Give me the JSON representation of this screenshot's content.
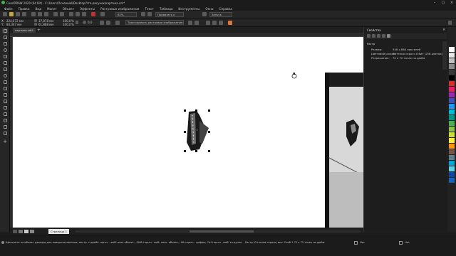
{
  "app": {
    "title": "CorelDRAW 2020 (64 Bit) - C:\\Users\\Основной\\Desktop\\Что-рисунок\\картина.cdr*"
  },
  "menu": [
    "Файл",
    "Правка",
    "Вид",
    "Макет",
    "Объект",
    "Эффекты",
    "Растровые изображения",
    "Текст",
    "Таблица",
    "Инструменты",
    "Окно",
    "Справка"
  ],
  "toolbar1": {
    "zoom": "62%",
    "snap_label": "Привязать к",
    "launch_label": "Запуск"
  },
  "toolbar2": {
    "x_value": "224,572 мм",
    "y_value": "84,347 мм",
    "w_value": "37,878 мм",
    "h_value": "61,888 мм",
    "scale_w": "100,0",
    "scale_h": "100,0",
    "percent": "%",
    "angle": "0,0",
    "dropdown": "Трассировать растровое изображение"
  },
  "document": {
    "tab_label": "картина.cdr*",
    "page_tab": "Страница 1"
  },
  "properties_panel": {
    "title": "Свойства",
    "section": "Растр",
    "rows": [
      {
        "label": "Размер:",
        "value": "346 x 864 пикселей"
      },
      {
        "label": "Цветовой режим:",
        "value": "Оттенки серого 8 бит (256 цветов)"
      },
      {
        "label": "Разрешение:",
        "value": "72 x 72 точек на дюйм"
      }
    ]
  },
  "status": {
    "hint": "Щелкните на объект дважды для поворота/наклона; инстр. с двойн. щелч. - выб. всех объект.; Shift+щелч - выб. неск. объект.; Alt+щелч - цифры; Ctrl+щелч - выб. в группе",
    "object_info": "Растр (Оттенки серого) вкл. Слой 1 72 x 72 точек на дюйм",
    "fill": "Нет",
    "outline": "Нет"
  },
  "colors": {
    "canvas": "#ffffff",
    "workspace": "#1e1e1e",
    "accent": "#2f6fd0"
  },
  "palette": [
    "#ffffff",
    "#e6e6e6",
    "#c0c0c0",
    "#8a8a8a",
    "#3a3a3a",
    "#000000",
    "#d32f2f",
    "#e91e63",
    "#9c27b0",
    "#3f51b5",
    "#2196f3",
    "#00bcd4",
    "#009688",
    "#4caf50",
    "#8bc34a",
    "#cddc39",
    "#ffeb3b",
    "#ff9800",
    "#795548",
    "#607d8b",
    "#00a6d6",
    "#5ad1e6",
    "#0d47a1",
    "#1565c0"
  ]
}
